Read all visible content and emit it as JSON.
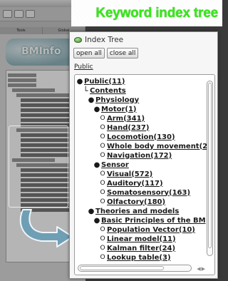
{
  "banner": {
    "title": "Keyword index tree"
  },
  "background_window": {
    "tabs": [
      "Tools",
      "Global"
    ],
    "logo_text": "BMInfo"
  },
  "panel": {
    "header": "Index Tree",
    "open_all_label": "open all",
    "close_all_label": "close all",
    "breadcrumb": "Public"
  },
  "tree": [
    {
      "label": "Public(11)",
      "prefix": "●"
    },
    {
      "label": "Contents",
      "prefix": "└"
    },
    {
      "label": "Physiology",
      "prefix": "●"
    },
    {
      "label": "Motor(1)",
      "prefix": "●"
    },
    {
      "label": "Arm(341)",
      "prefix": "O"
    },
    {
      "label": "Hand(237)",
      "prefix": "O"
    },
    {
      "label": "Locomotion(130)",
      "prefix": "O"
    },
    {
      "label": "Whole body movement(2",
      "prefix": "O"
    },
    {
      "label": "Navigation(172)",
      "prefix": "O"
    },
    {
      "label": "Sensor",
      "prefix": "●"
    },
    {
      "label": "Visual(572)",
      "prefix": "O"
    },
    {
      "label": "Auditory(117)",
      "prefix": "O"
    },
    {
      "label": "Somatosensory(163)",
      "prefix": "O"
    },
    {
      "label": "Olfactory(180)",
      "prefix": "O"
    },
    {
      "label": "Theories and models",
      "prefix": "●"
    },
    {
      "label": "Basic Principles of the BM",
      "prefix": "●"
    },
    {
      "label": "Population Vector(10)",
      "prefix": "O"
    },
    {
      "label": "Linear model(11)",
      "prefix": "O"
    },
    {
      "label": "Kalman filter(24)",
      "prefix": "O"
    },
    {
      "label": "Lookup table(3)",
      "prefix": "O"
    }
  ],
  "colors": {
    "banner_text": "#37e818",
    "arrow_fill": "#6f9fb5"
  }
}
